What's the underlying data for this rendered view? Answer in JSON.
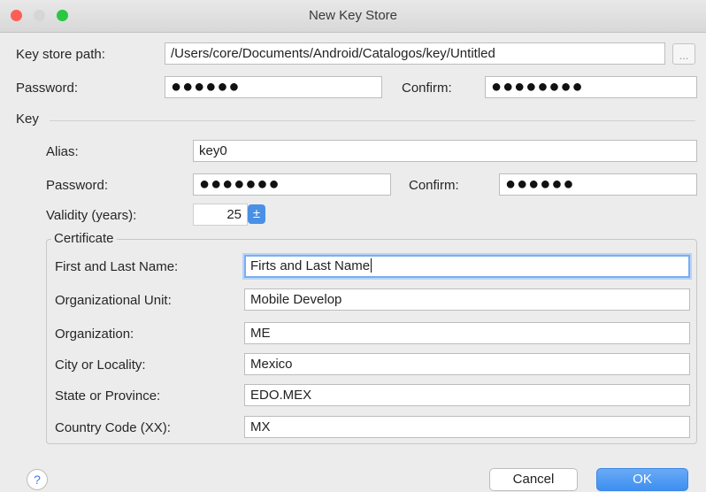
{
  "window": {
    "title": "New Key Store"
  },
  "keystore": {
    "path_label": "Key store path:",
    "path_value": "/Users/core/Documents/Android/Catalogos/key/Untitled",
    "browse_label": "...",
    "password_label": "Password:",
    "password_mask": "●●●●●●",
    "confirm_label": "Confirm:",
    "confirm_mask": "●●●●●●●●"
  },
  "key": {
    "section_label": "Key",
    "alias_label": "Alias:",
    "alias_value": "key0",
    "password_label": "Password:",
    "password_mask": "●●●●●●●",
    "confirm_label": "Confirm:",
    "confirm_mask": "●●●●●●",
    "validity_label": "Validity (years):",
    "validity_value": "25",
    "stepper_glyph": "±"
  },
  "certificate": {
    "legend": "Certificate",
    "fields": {
      "name_label": "First and Last Name:",
      "name_value": "Firts and Last Name",
      "org_unit_label": "Organizational Unit:",
      "org_unit_value": "Mobile Develop",
      "org_label": "Organization:",
      "org_value": "ME",
      "city_label": "City or Locality:",
      "city_value": "Mexico",
      "state_label": "State or Province:",
      "state_value": "EDO.MEX",
      "country_label": "Country Code (XX):",
      "country_value": "MX"
    }
  },
  "footer": {
    "help_glyph": "?",
    "cancel_label": "Cancel",
    "ok_label": "OK"
  },
  "colors": {
    "close": "#fd5f57",
    "minimize": "#d6d6d6",
    "zoom": "#28c840",
    "accent": "#4a90e6",
    "focus_ring": "#7aaef0"
  },
  "icons": [
    "close-icon",
    "minimize-icon",
    "zoom-icon",
    "stepper-icon",
    "help-icon"
  ]
}
